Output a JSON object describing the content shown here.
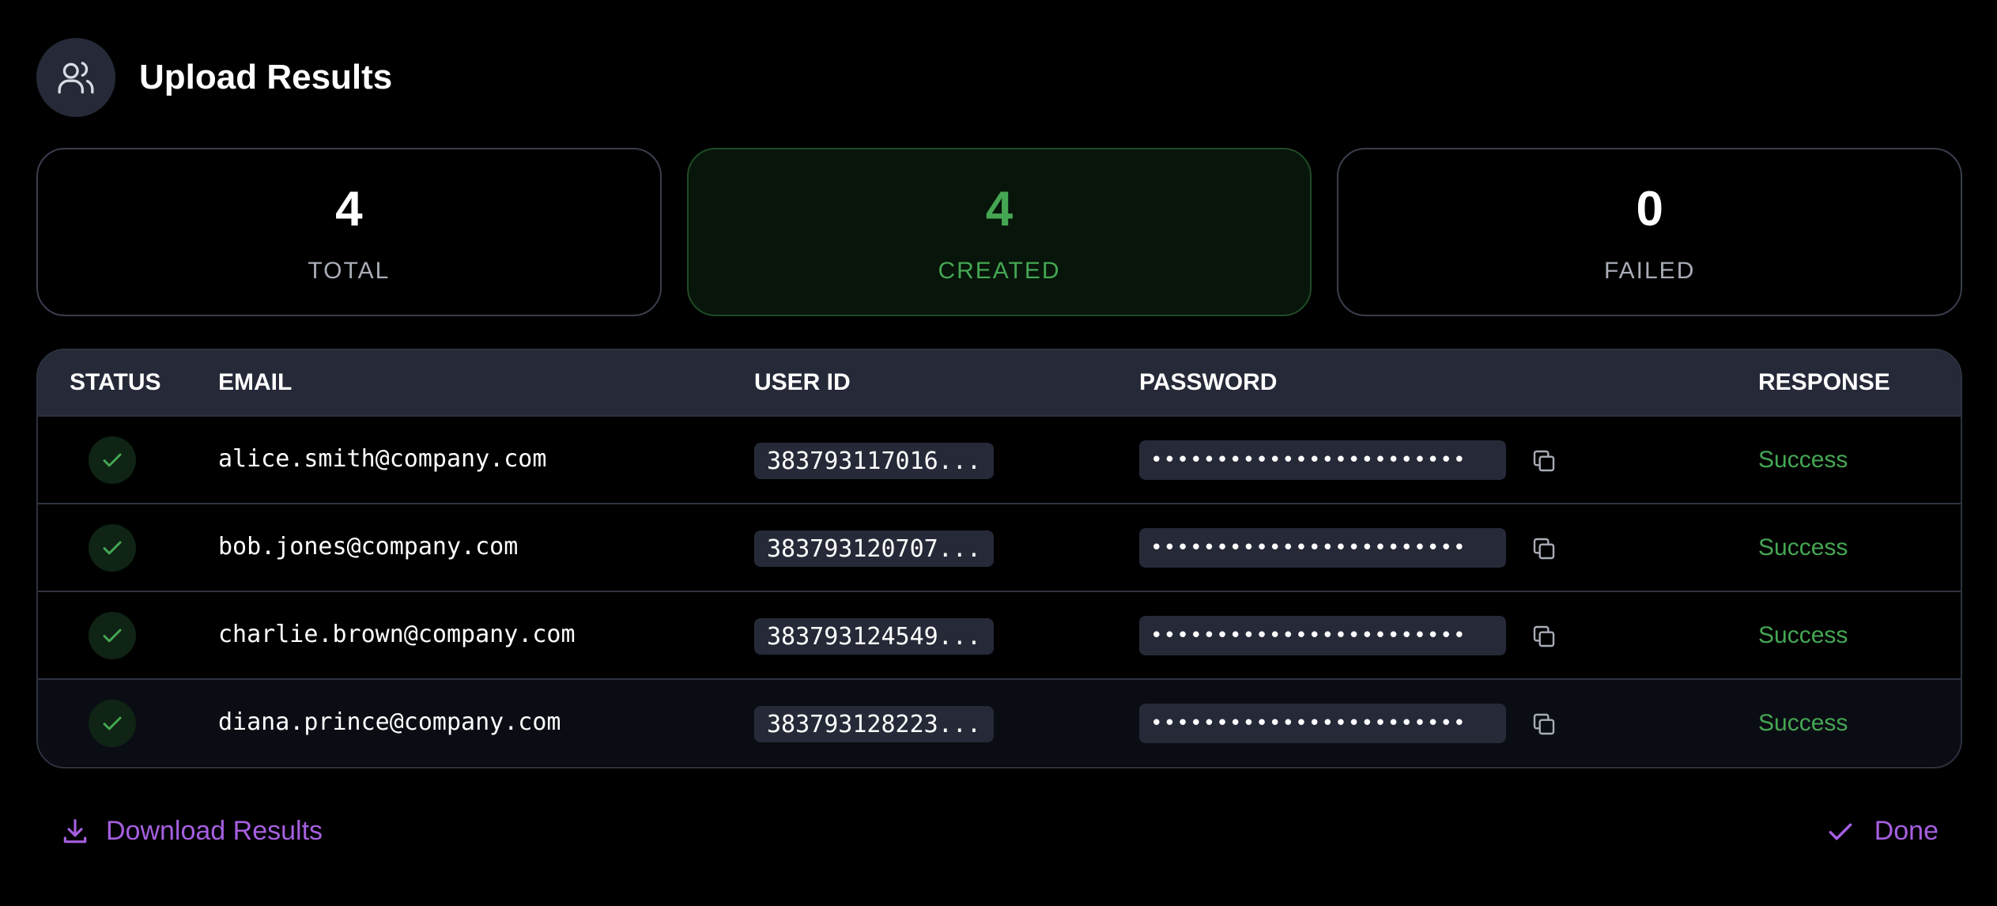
{
  "header": {
    "title": "Upload Results",
    "icon": "users-icon"
  },
  "stats": [
    {
      "value": "4",
      "label": "TOTAL"
    },
    {
      "value": "4",
      "label": "CREATED"
    },
    {
      "value": "0",
      "label": "FAILED"
    }
  ],
  "table": {
    "headers": [
      "STATUS",
      "EMAIL",
      "USER ID",
      "PASSWORD",
      "RESPONSE"
    ],
    "rows": [
      {
        "email": "alice.smith@company.com",
        "user_id": "383793117016...",
        "password": "••••••••••••••••••••••••",
        "response": "Success"
      },
      {
        "email": "bob.jones@company.com",
        "user_id": "383793120707...",
        "password": "••••••••••••••••••••••••",
        "response": "Success"
      },
      {
        "email": "charlie.brown@company.com",
        "user_id": "383793124549...",
        "password": "••••••••••••••••••••••••",
        "response": "Success"
      },
      {
        "email": "diana.prince@company.com",
        "user_id": "383793128223...",
        "password": "••••••••••••••••••••••••",
        "response": "Success"
      }
    ]
  },
  "footer": {
    "download_label": "Download Results",
    "done_label": "Done"
  },
  "colors": {
    "accent": "#a65fe0",
    "success": "#45a653",
    "surface": "#262a38",
    "border": "#2e3240"
  }
}
